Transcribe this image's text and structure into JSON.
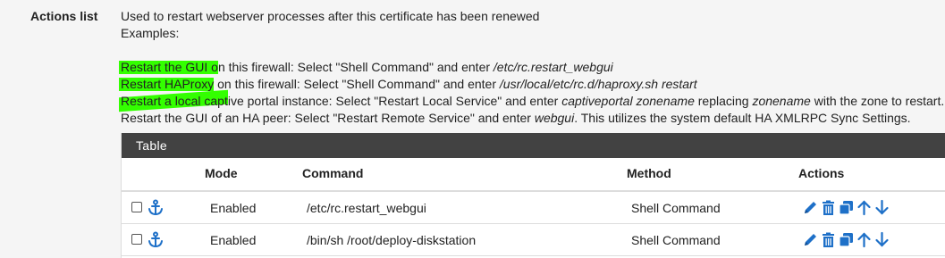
{
  "field": {
    "label": "Actions list"
  },
  "description": {
    "line1": "Used to restart webserver processes after this certificate has been renewed",
    "line2": "Examples:",
    "ex1_hl": "Restart the GUI o",
    "ex1_rest": "n this firewall: Select \"Shell Command\" and enter ",
    "ex1_cmd": "/etc/rc.restart_webgui",
    "ex2_hl": "Restart HAProxy",
    "ex2_rest": " on this firewall: Select \"Shell Command\" and enter ",
    "ex2_cmd": "/usr/local/etc/rc.d/haproxy.sh restart",
    "ex3_hl": "Restart a local capt",
    "ex3_rest": "ive portal instance: Select \"Restart Local Service\" and enter ",
    "ex3_it1": "captiveportal zonename",
    "ex3_mid": " replacing ",
    "ex3_it2": "zonename",
    "ex3_end": " with the zone to restart.",
    "ex4_pre": "Restart the GUI of an HA peer: Select \"Restart Remote Service\" and enter ",
    "ex4_it": "webgui",
    "ex4_end": ". This utilizes the system default HA XMLRPC Sync Settings.",
    "highlight_color": "#33ff00"
  },
  "table": {
    "title": "Table",
    "columns": {
      "mode": "Mode",
      "command": "Command",
      "method": "Method",
      "actions": "Actions"
    },
    "rows": [
      {
        "mode": "Enabled",
        "command": "/etc/rc.restart_webgui",
        "method": "Shell Command"
      },
      {
        "mode": "Enabled",
        "command": "/bin/sh /root/deploy-diskstation",
        "method": "Shell Command"
      }
    ],
    "header_color": "#424242",
    "icon_color": "#1e70c8"
  }
}
